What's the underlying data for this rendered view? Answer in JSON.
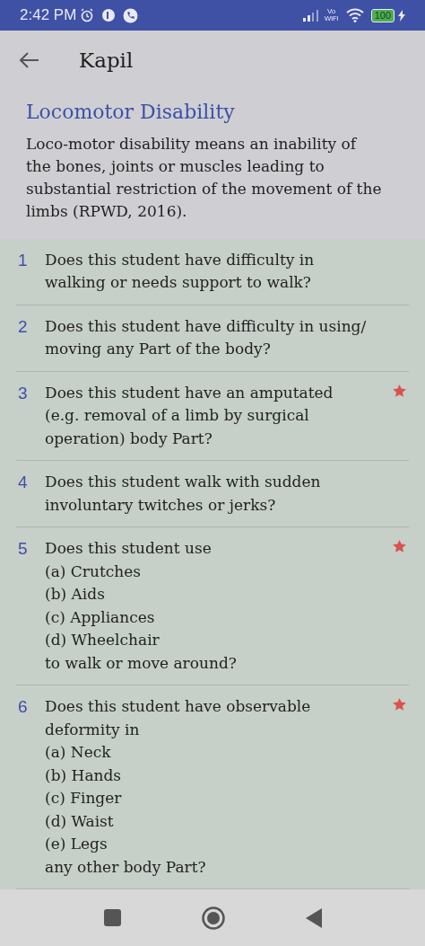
{
  "status_bar": {
    "time": "2:42 PM",
    "network_label": "Vo\nWiFi",
    "battery": "100"
  },
  "app_bar": {
    "title": "Kapil"
  },
  "section": {
    "title": "Locomotor Disability",
    "description": "Loco-motor disability means an inability of the bones, joints or muscles leading to substantial restriction of the movement of the limbs (RPWD, 2016)."
  },
  "questions": [
    {
      "number": "1",
      "text": "Does this student have difficulty in\nwalking or needs support to walk?",
      "starred": false
    },
    {
      "number": "2",
      "text": "Does this student have difficulty in using/\nmoving any Part of the body?",
      "starred": false
    },
    {
      "number": "3",
      "text": "Does this student have an amputated\n(e.g. removal of a limb by surgical\noperation) body Part?",
      "starred": true
    },
    {
      "number": "4",
      "text": "Does this student walk with sudden\ninvoluntary twitches or jerks?",
      "starred": false
    },
    {
      "number": "5",
      "text": "Does this student use\n(a) Crutches\n(b) Aids\n(c) Appliances\n(d) Wheelchair\nto walk or move around?",
      "starred": true
    },
    {
      "number": "6",
      "text": "Does this student have observable\ndeformity in\n(a) Neck\n(b) Hands\n(c) Finger\n(d) Waist\n(e) Legs\nany other body Part?",
      "starred": true
    }
  ]
}
